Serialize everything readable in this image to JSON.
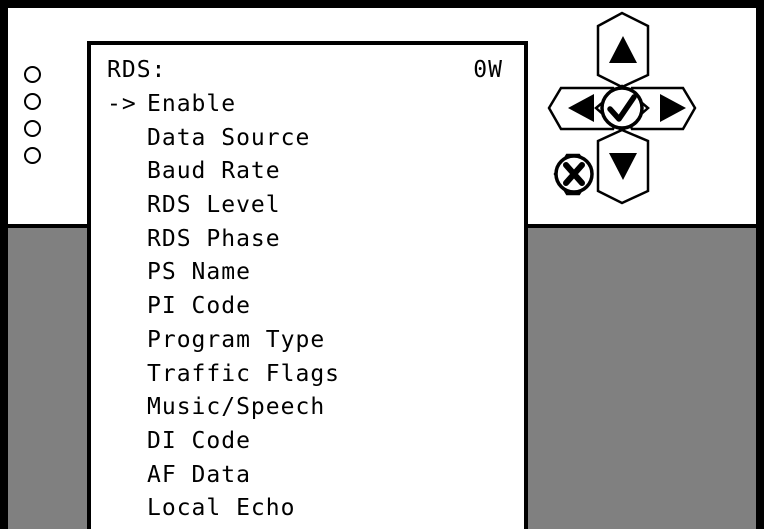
{
  "screen": {
    "title": "RDS:",
    "power": "0W",
    "cursor": "->",
    "menu": [
      {
        "label": "Enable",
        "selected": true
      },
      {
        "label": "Data Source",
        "selected": false
      },
      {
        "label": "Baud Rate",
        "selected": false
      },
      {
        "label": "RDS Level",
        "selected": false
      },
      {
        "label": "RDS Phase",
        "selected": false
      },
      {
        "label": "PS Name",
        "selected": false
      },
      {
        "label": "PI Code",
        "selected": false
      },
      {
        "label": "Program Type",
        "selected": false
      },
      {
        "label": "Traffic Flags",
        "selected": false
      },
      {
        "label": "Music/Speech",
        "selected": false
      },
      {
        "label": "DI Code",
        "selected": false
      },
      {
        "label": "AF Data",
        "selected": false
      },
      {
        "label": "Local Echo",
        "selected": false
      }
    ]
  },
  "leds": [
    "status-led-1",
    "status-led-2",
    "status-led-3",
    "status-led-4"
  ],
  "nav": {
    "up": "up-arrow-icon",
    "down": "down-arrow-icon",
    "left": "left-arrow-icon",
    "right": "right-arrow-icon",
    "enter": "checkmark-icon",
    "cancel": "x-icon"
  },
  "colors": {
    "background": "#ffffff",
    "lower_panel": "#808080",
    "ink": "#000000"
  }
}
